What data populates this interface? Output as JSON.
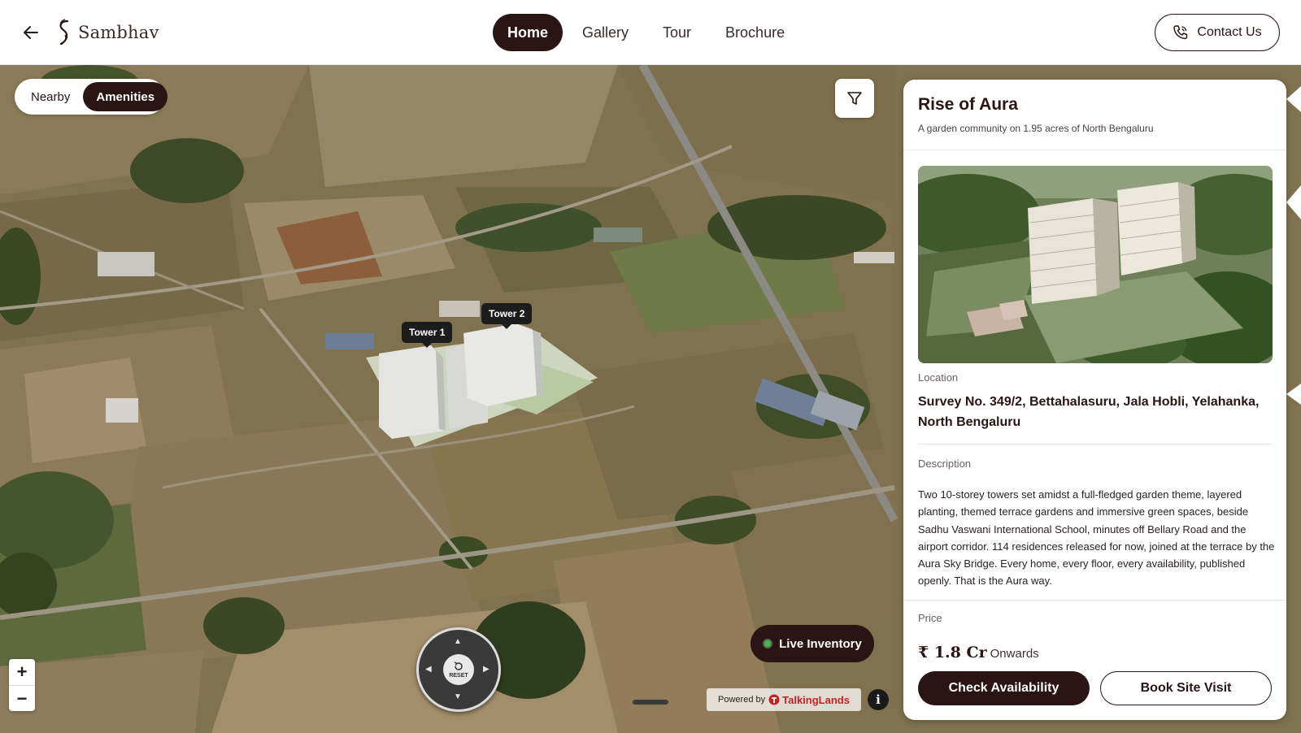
{
  "header": {
    "back_icon": "arrow-left-icon",
    "logo_icon": "sambhav-s-logo-icon",
    "logo_text": "Sambhav",
    "nav": [
      {
        "label": "Home",
        "active": true
      },
      {
        "label": "Gallery",
        "active": false
      },
      {
        "label": "Tour",
        "active": false
      },
      {
        "label": "Brochure",
        "active": false
      }
    ],
    "contact_label": "Contact Us",
    "contact_icon": "phone-icon"
  },
  "map": {
    "toggle": [
      {
        "label": "Nearby",
        "active": false
      },
      {
        "label": "Amenities",
        "active": true
      }
    ],
    "filter_icon": "filter-funnel-icon",
    "towers": [
      {
        "label": "Tower 1"
      },
      {
        "label": "Tower 2"
      }
    ],
    "compass_reset_label": "RESET",
    "live_inventory_label": "Live Inventory",
    "live_status_color": "#3fbf3f",
    "zoom_in_label": "+",
    "zoom_out_label": "−",
    "powered_prefix": "Powered by",
    "powered_brand": "TalkingLands",
    "info_icon": "info-icon",
    "info_label": "i"
  },
  "panel": {
    "title": "Rise of Aura",
    "subtitle": "A garden community on 1.95 acres of North Bengaluru",
    "image_alt": "tower-rendering",
    "location_label": "Location",
    "location": "Survey No. 349/2, Bettahalasuru, Jala Hobli, Yelahanka, North Bengaluru",
    "description_label": "Description",
    "description": "Two 10-storey towers set amidst a full-fledged garden theme, layered planting, themed terrace gardens and immersive green spaces, beside Sadhu Vaswani International School, minutes off Bellary Road and the airport corridor. 114 residences released for now, joined at the terrace by the Aura Sky Bridge. Every home, every floor, every availability, published openly. That is the Aura way.",
    "price_label": "Price",
    "price_value": "₹ 1.8 Cr",
    "price_suffix": "Onwards",
    "primary_button": "Check Availability",
    "secondary_button": "Book Site Visit"
  },
  "colors": {
    "brand": "#2a1414",
    "accent_live": "#3fbf3f"
  }
}
